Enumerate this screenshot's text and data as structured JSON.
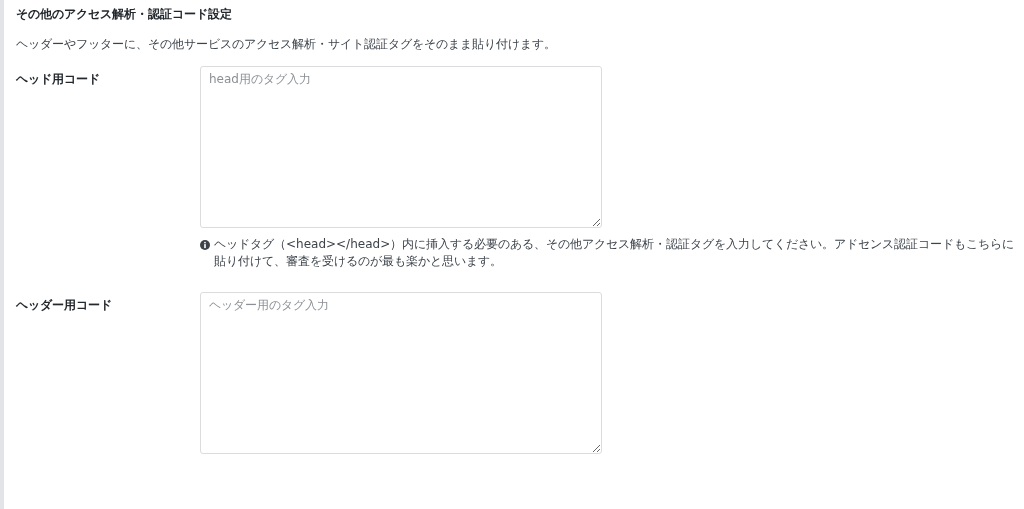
{
  "section": {
    "title": "その他のアクセス解析・認証コード設定",
    "description": "ヘッダーやフッターに、その他サービスのアクセス解析・サイト認証タグをそのまま貼り付けます。"
  },
  "fields": [
    {
      "label": "ヘッド用コード",
      "placeholder": "head用のタグ入力",
      "help": "ヘッドタグ（<head></head>）内に挿入する必要のある、その他アクセス解析・認証タグを入力してください。アドセンス認証コードもこちらに貼り付けて、審査を受けるのが最も楽かと思います。"
    },
    {
      "label": "ヘッダー用コード",
      "placeholder": "ヘッダー用のタグ入力"
    }
  ]
}
